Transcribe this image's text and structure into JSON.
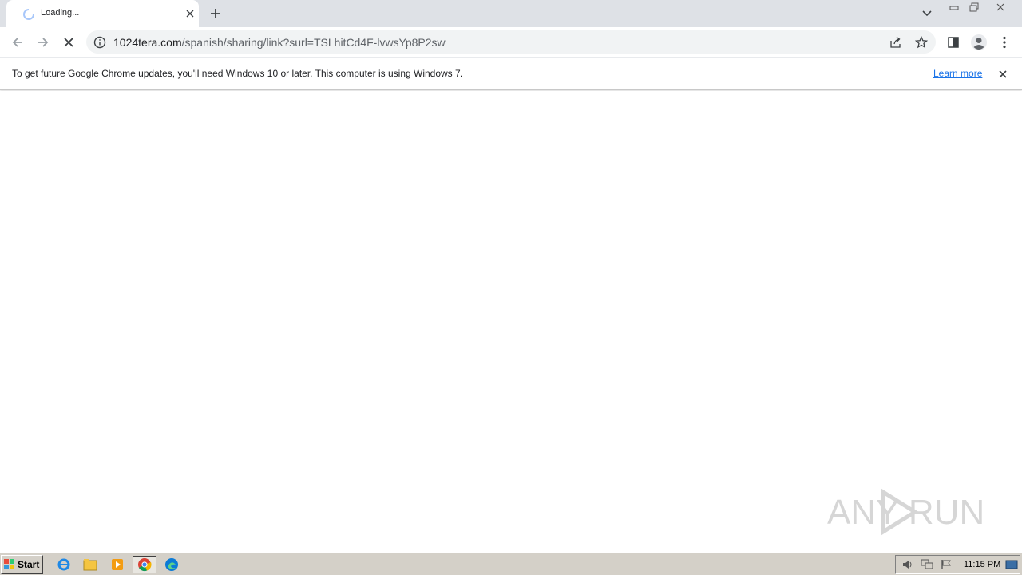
{
  "browser": {
    "tab": {
      "title": "Loading...",
      "close_icon": "close-icon"
    },
    "toolbar": {
      "url_host": "1024tera.com",
      "url_path": "/spanish/sharing/link?surl=TSLhitCd4F-lvwsYp8P2sw"
    },
    "infobar": {
      "message": "To get future Google Chrome updates, you'll need Windows 10 or later. This computer is using Windows 7.",
      "link_label": "Learn more"
    }
  },
  "watermark": {
    "text": "ANY RUN"
  },
  "taskbar": {
    "start_label": "Start",
    "clock": "11:15 PM"
  },
  "colors": {
    "tabstrip": "#dee1e6",
    "accent_link": "#1a73e8",
    "taskbar": "#d4d0c8"
  }
}
